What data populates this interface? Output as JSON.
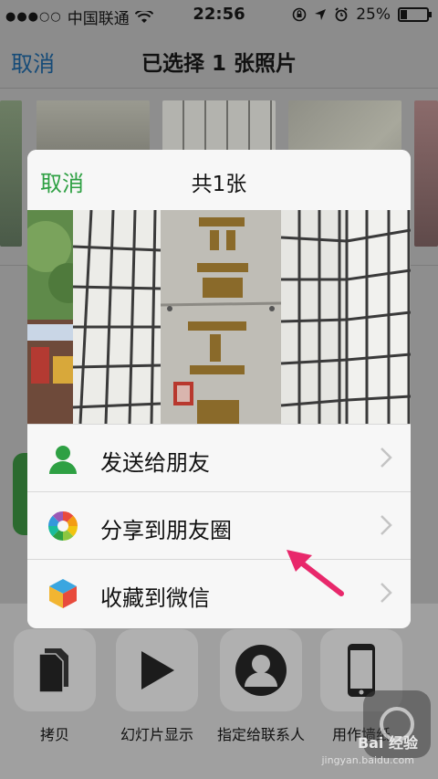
{
  "status_bar": {
    "signal": "●●●○○",
    "carrier": "中国联通",
    "time": "22:56",
    "battery_percent": "25%",
    "battery_level": 0.25
  },
  "nav": {
    "cancel_label": "取消",
    "title": "已选择 1 张照片"
  },
  "dialog": {
    "cancel_label": "取消",
    "title": "共1张",
    "menu": [
      {
        "label": "发送给朋友",
        "icon": "contact-icon"
      },
      {
        "label": "分享到朋友圈",
        "icon": "moments-icon"
      },
      {
        "label": "收藏到微信",
        "icon": "favorites-icon"
      }
    ]
  },
  "actions": [
    {
      "label": "拷贝",
      "icon": "copy-icon"
    },
    {
      "label": "幻灯片显示",
      "icon": "slideshow-icon"
    },
    {
      "label": "指定给联系人",
      "icon": "assign-contact-icon"
    },
    {
      "label": "用作墙纸",
      "icon": "wallpaper-icon"
    }
  ],
  "watermark": {
    "text": "Bai 经验",
    "sub": "jingyan.baidu.com"
  },
  "colors": {
    "wechat_green": "#2ea043",
    "ios_blue_dimmed": "#164b78",
    "arrow_pink": "#e8286b"
  }
}
